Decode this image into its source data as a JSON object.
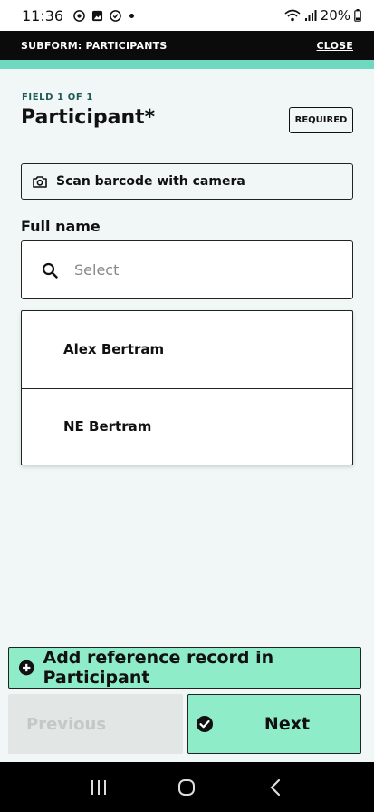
{
  "status_bar": {
    "time": "11:36",
    "battery": "20%"
  },
  "header": {
    "title": "SUBFORM: PARTICIPANTS",
    "close_label": "CLOSE"
  },
  "field": {
    "counter": "FIELD 1 OF 1",
    "title": "Participant*",
    "required_label": "REQUIRED"
  },
  "scan": {
    "label": "Scan barcode with camera"
  },
  "full_name": {
    "label": "Full name",
    "placeholder": "Select",
    "value": ""
  },
  "options": [
    {
      "label": "Alex Bertram"
    },
    {
      "label": "NE Bertram"
    }
  ],
  "actions": {
    "add_reference_label": "Add reference record in Participant",
    "previous_label": "Previous",
    "next_label": "Next"
  },
  "colors": {
    "accent": "#8eecc8",
    "progress": "#6fd9c0",
    "background": "#f0f7f6",
    "header_bg": "#0b0b0b"
  }
}
